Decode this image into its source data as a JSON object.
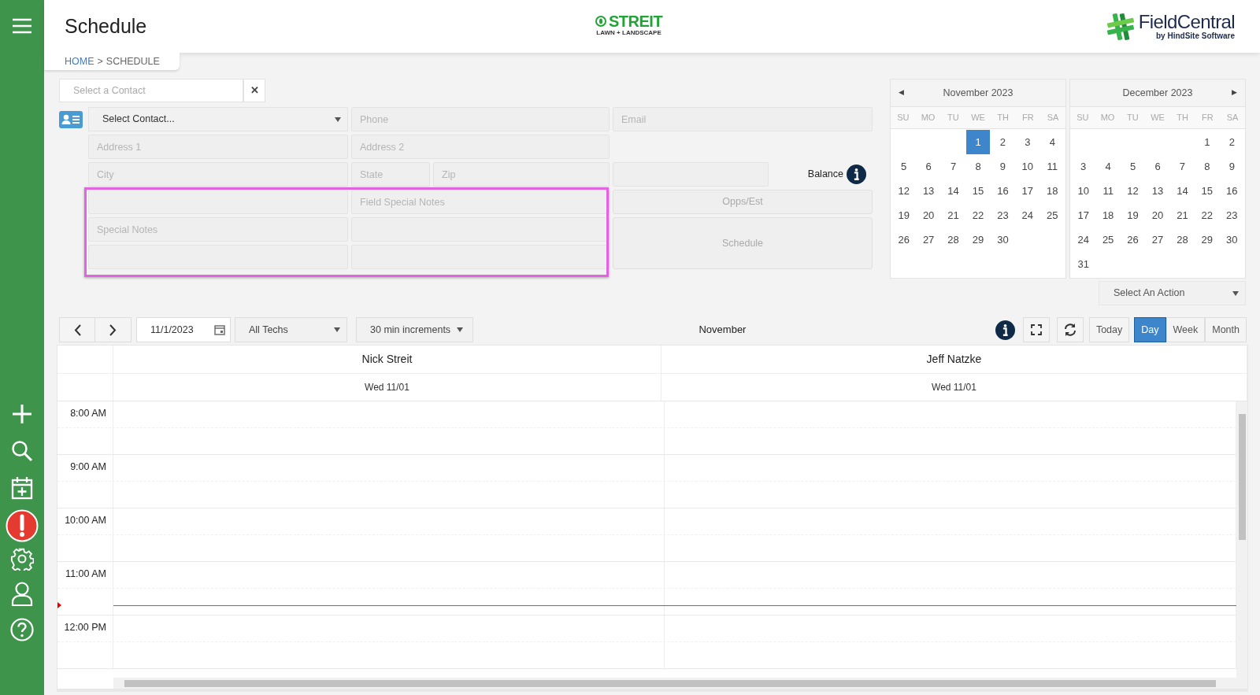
{
  "header": {
    "title": "Schedule",
    "brand": {
      "name": "STREIT",
      "tagline": "LAWN + LANDSCAPE"
    },
    "product": {
      "name": "FieldCentral",
      "byline": "by HindSite Software"
    }
  },
  "breadcrumb": {
    "link": "HOME",
    "separator": ">",
    "current": "SCHEDULE"
  },
  "contact_search": {
    "placeholder": "Select a Contact",
    "clear": "✕"
  },
  "contact_form": {
    "contact_select": "Select Contact...",
    "phone": {
      "placeholder": "Phone"
    },
    "email": {
      "placeholder": "Email"
    },
    "address1": {
      "placeholder": "Address 1"
    },
    "address2": {
      "placeholder": "Address 2"
    },
    "city": {
      "placeholder": "City"
    },
    "state": {
      "placeholder": "State"
    },
    "zip": {
      "placeholder": "Zip"
    },
    "balance_label": "Balance",
    "opps_button": "Opps/Est",
    "schedule_button": "Schedule",
    "field_special_notes": {
      "placeholder": "Field Special Notes"
    },
    "special_notes": {
      "placeholder": "Special Notes"
    }
  },
  "calendars": [
    {
      "title": "November 2023",
      "prev_arrow": "◀",
      "weekdays": [
        "SU",
        "MO",
        "TU",
        "WE",
        "TH",
        "FR",
        "SA"
      ],
      "weeks": [
        [
          {
            "kind": "blank"
          },
          {
            "kind": "blank"
          },
          {
            "kind": "blank"
          },
          {
            "day": "1",
            "selected": true
          },
          {
            "day": "2",
            "selected": false
          },
          {
            "day": "3",
            "selected": false
          },
          {
            "day": "4",
            "selected": false
          }
        ],
        [
          {
            "day": "5",
            "selected": false
          },
          {
            "day": "6",
            "selected": false
          },
          {
            "day": "7",
            "selected": false
          },
          {
            "day": "8",
            "selected": false
          },
          {
            "day": "9",
            "selected": false
          },
          {
            "day": "10",
            "selected": false
          },
          {
            "day": "11",
            "selected": false
          }
        ],
        [
          {
            "day": "12",
            "selected": false
          },
          {
            "day": "13",
            "selected": false
          },
          {
            "day": "14",
            "selected": false
          },
          {
            "day": "15",
            "selected": false
          },
          {
            "day": "16",
            "selected": false
          },
          {
            "day": "17",
            "selected": false
          },
          {
            "day": "18",
            "selected": false
          }
        ],
        [
          {
            "day": "19",
            "selected": false
          },
          {
            "day": "20",
            "selected": false
          },
          {
            "day": "21",
            "selected": false
          },
          {
            "day": "22",
            "selected": false
          },
          {
            "day": "23",
            "selected": false
          },
          {
            "day": "24",
            "selected": false
          },
          {
            "day": "25",
            "selected": false
          }
        ],
        [
          {
            "day": "26",
            "selected": false
          },
          {
            "day": "27",
            "selected": false
          },
          {
            "day": "28",
            "selected": false
          },
          {
            "day": "29",
            "selected": false
          },
          {
            "day": "30",
            "selected": false
          },
          {
            "kind": "blank"
          },
          {
            "kind": "blank"
          }
        ]
      ]
    },
    {
      "title": "December 2023",
      "next_arrow": "▶",
      "weekdays": [
        "SU",
        "MO",
        "TU",
        "WE",
        "TH",
        "FR",
        "SA"
      ],
      "weeks": [
        [
          {
            "kind": "blank"
          },
          {
            "kind": "blank"
          },
          {
            "kind": "blank"
          },
          {
            "kind": "blank"
          },
          {
            "kind": "blank"
          },
          {
            "day": "1",
            "selected": false
          },
          {
            "day": "2",
            "selected": false
          }
        ],
        [
          {
            "day": "3",
            "selected": false
          },
          {
            "day": "4",
            "selected": false
          },
          {
            "day": "5",
            "selected": false
          },
          {
            "day": "6",
            "selected": false
          },
          {
            "day": "7",
            "selected": false
          },
          {
            "day": "8",
            "selected": false
          },
          {
            "day": "9",
            "selected": false
          }
        ],
        [
          {
            "day": "10",
            "selected": false
          },
          {
            "day": "11",
            "selected": false
          },
          {
            "day": "12",
            "selected": false
          },
          {
            "day": "13",
            "selected": false
          },
          {
            "day": "14",
            "selected": false
          },
          {
            "day": "15",
            "selected": false
          },
          {
            "day": "16",
            "selected": false
          }
        ],
        [
          {
            "day": "17",
            "selected": false
          },
          {
            "day": "18",
            "selected": false
          },
          {
            "day": "19",
            "selected": false
          },
          {
            "day": "20",
            "selected": false
          },
          {
            "day": "21",
            "selected": false
          },
          {
            "day": "22",
            "selected": false
          },
          {
            "day": "23",
            "selected": false
          }
        ],
        [
          {
            "day": "24",
            "selected": false
          },
          {
            "day": "25",
            "selected": false
          },
          {
            "day": "26",
            "selected": false
          },
          {
            "day": "27",
            "selected": false
          },
          {
            "day": "28",
            "selected": false
          },
          {
            "day": "29",
            "selected": false
          },
          {
            "day": "30",
            "selected": false
          }
        ],
        [
          {
            "day": "31",
            "selected": false
          }
        ]
      ]
    }
  ],
  "action_select": "Select An Action",
  "toolbar": {
    "date": "11/1/2023",
    "techs": "All Techs",
    "increments": "30 min increments",
    "period": "November",
    "views": [
      {
        "label": "Today",
        "selected": false
      },
      {
        "label": "Day",
        "selected": true
      },
      {
        "label": "Week",
        "selected": false
      },
      {
        "label": "Month",
        "selected": false
      }
    ]
  },
  "scheduler": {
    "columns": [
      {
        "name": "Nick Streit",
        "date": "Wed 11/01"
      },
      {
        "name": "Jeff Natzke",
        "date": "Wed 11/01"
      }
    ],
    "times": [
      "8:00 AM",
      "9:00 AM",
      "10:00 AM",
      "11:00 AM",
      "12:00 PM"
    ]
  }
}
